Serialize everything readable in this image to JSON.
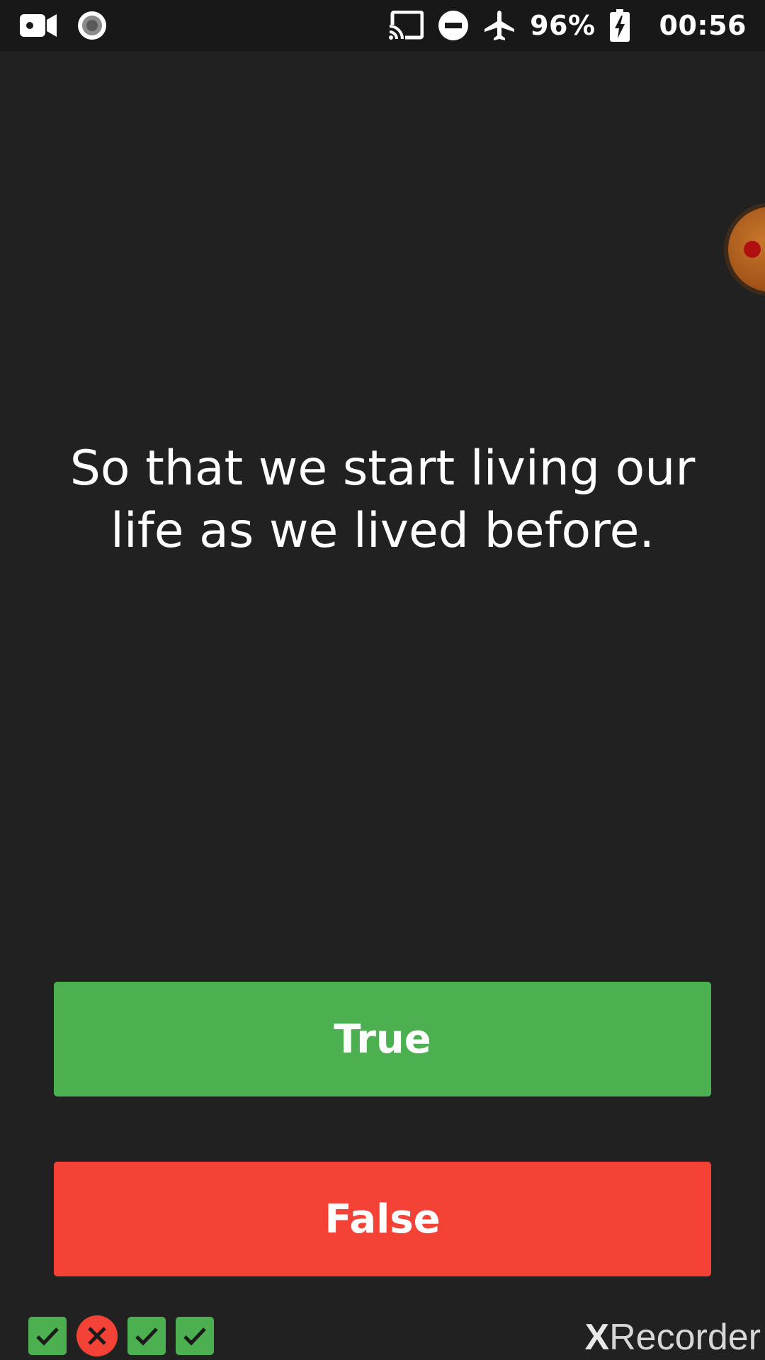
{
  "status_bar": {
    "left_icons": [
      "video-camera-icon",
      "record-icon"
    ],
    "right_icons": [
      "cast-icon",
      "do-not-disturb-icon",
      "airplane-icon"
    ],
    "battery_percent": "96%",
    "battery_icon": "battery-charging-icon",
    "time": "00:56"
  },
  "floating_recorder": {
    "icon": "recorder-bubble-icon"
  },
  "question": {
    "text": "So that we start living our life as we lived before."
  },
  "answers": {
    "true_label": "True",
    "false_label": "False"
  },
  "progress": {
    "results": [
      "correct",
      "wrong",
      "correct",
      "correct"
    ]
  },
  "watermark": {
    "x": "X",
    "rest": "Recorder"
  },
  "colors": {
    "background": "#212121",
    "status_bar": "#181818",
    "true_green": "#4caf50",
    "false_red": "#f44336"
  }
}
